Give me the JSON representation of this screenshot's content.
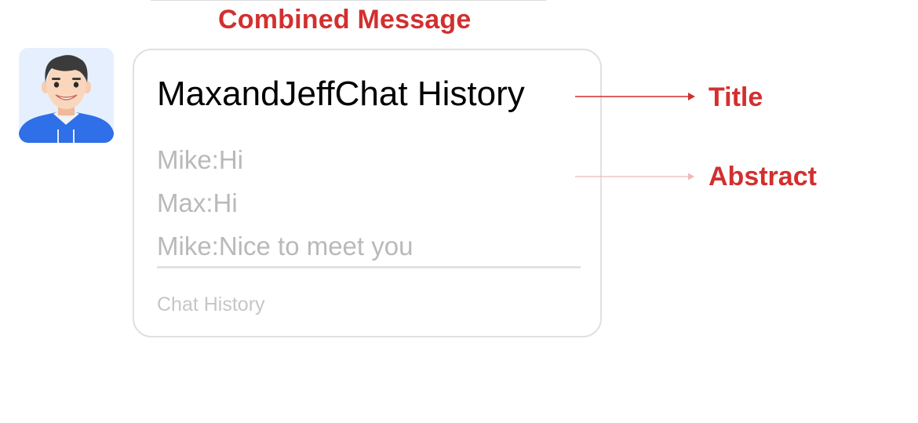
{
  "heading": "Combined Message",
  "card": {
    "title": "MaxandJeffChat History",
    "abstract": [
      "Mike:Hi",
      "Max:Hi",
      "Mike:Nice to meet you"
    ],
    "footer": "Chat History"
  },
  "callouts": {
    "title_label": "Title",
    "abstract_label": "Abstract"
  },
  "colors": {
    "annotation": "#d32f2f",
    "annotation_faint": "#f2b8b8",
    "card_border": "#e0e0e0",
    "abstract_text": "#b9b9b9",
    "avatar_bg": "#e6effd",
    "avatar_shirt": "#2f6fe8"
  },
  "icons": {
    "avatar": "user-avatar-icon"
  }
}
